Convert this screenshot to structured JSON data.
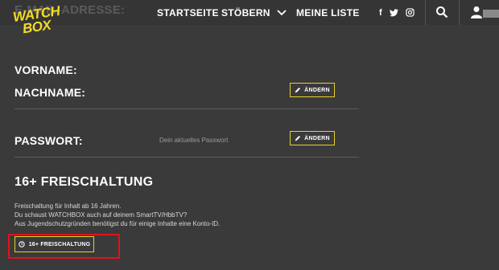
{
  "header": {
    "ghost_label": "E-MAIL-ADRESSE:",
    "logo": {
      "line1": "WATCH",
      "line2": "BOX"
    },
    "nav": [
      {
        "label": "STARTSEITE"
      },
      {
        "label": "STÖBERN",
        "icon": "chevron-down-icon"
      },
      {
        "label": "MEINE LISTE"
      }
    ],
    "social": [
      {
        "label": "f",
        "icon": "facebook-icon"
      },
      {
        "label": "t",
        "icon": "twitter-icon"
      },
      {
        "label": "",
        "icon": "instagram-icon"
      }
    ],
    "search_icon": "search-icon",
    "user_icon": "user-icon"
  },
  "form": {
    "vorname_label": "VORNAME:",
    "nachname_label": "NACHNAME:",
    "nachname_edit": "ÄNDERN",
    "passwort_label": "PASSWORT:",
    "passwort_hint": "Dein aktuelles Passwort",
    "passwort_edit": "ÄNDERN"
  },
  "unlock": {
    "title": "16+ FREISCHALTUNG",
    "lines": [
      "Freischaltung für Inhalt ab 16 Jahren.",
      "Du schaust WATCHBOX auch auf deinem SmartTV/HbbTV?",
      "Aus Jugendschutzgründen benötigst du für einige Inhalte eine Konto-ID."
    ],
    "button_label": "16+ FREISCHALTUNG"
  },
  "colors": {
    "accent": "#e7cf2b",
    "highlight": "#e0121b",
    "background": "#3a3a3a"
  }
}
